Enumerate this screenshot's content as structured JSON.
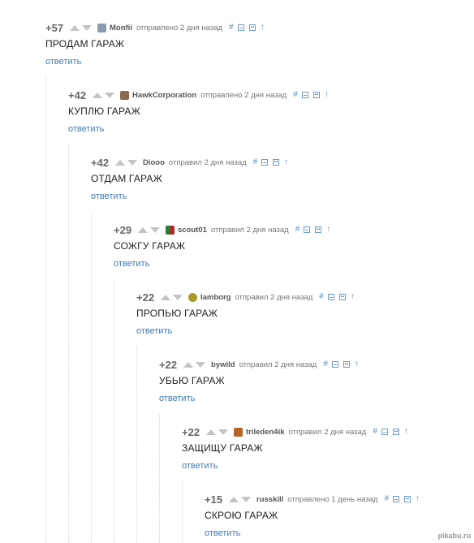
{
  "comments": [
    {
      "rating": "+57",
      "username": "Monfii",
      "posted": "отправлено 2 дня назад",
      "text": "ПРОДАМ ГАРАЖ",
      "reply": "ответить",
      "avatar_color": "#8a9bb0"
    },
    {
      "rating": "+42",
      "username": "HawkCorporation",
      "posted": "отправлено 2 дня назад",
      "text": "КУПЛЮ ГАРАЖ",
      "reply": "ответить",
      "avatar_color": "#8b6a4e"
    },
    {
      "rating": "+42",
      "username": "Diooo",
      "posted": "отправил 2 дня назад",
      "text": "ОТДАМ ГАРАЖ",
      "reply": "ответить",
      "avatar_color": ""
    },
    {
      "rating": "+29",
      "username": "scout01",
      "posted": "отправил 2 дня назад",
      "text": "СОЖГУ ГАРАЖ",
      "reply": "ответить",
      "avatar_color": "#3a8a3a"
    },
    {
      "rating": "+22",
      "username": "lamborg",
      "posted": "отправил 2 дня назад",
      "text": "ПРОПЬЮ ГАРАЖ",
      "reply": "ответить",
      "avatar_color": "#a89a2a"
    },
    {
      "rating": "+22",
      "username": "bywild",
      "posted": "отправил 2 дня назад",
      "text": "УБЬЮ ГАРАЖ",
      "reply": "ответить",
      "avatar_color": ""
    },
    {
      "rating": "+22",
      "username": "trileden4ik",
      "posted": "отправил 2 дня назад",
      "text": "ЗАЩИЩУ ГАРАЖ",
      "reply": "ответить",
      "avatar_color": "#b5652a"
    },
    {
      "rating": "+15",
      "username": "russkill",
      "posted": "отправлено 1 день назад",
      "text": "СКРОЮ ГАРАЖ",
      "reply": "ответить",
      "avatar_color": ""
    }
  ],
  "tools": {
    "link": "#",
    "up_arrow": "↑"
  },
  "watermark": "pikabu.ru"
}
